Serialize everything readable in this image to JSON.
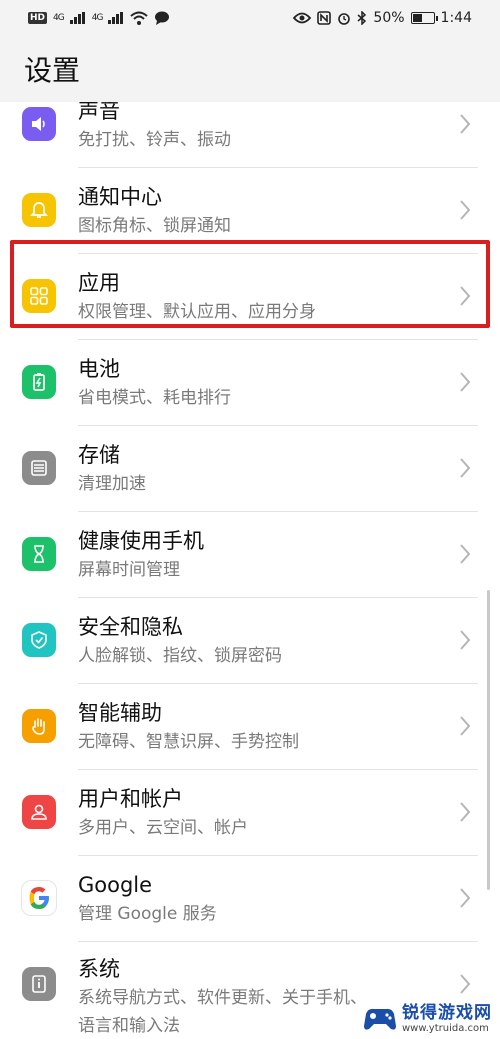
{
  "status_bar": {
    "hd": "HD",
    "signal_1": "4G",
    "signal_2": "4G",
    "battery_percent": "50%",
    "battery_level": 0.5,
    "time": "1:44"
  },
  "header": {
    "title": "设置"
  },
  "settings": [
    {
      "title": "声音",
      "subtitle": "免打扰、铃声、振动",
      "icon": "speaker-icon",
      "color": "#7a5cf0"
    },
    {
      "title": "通知中心",
      "subtitle": "图标角标、锁屏通知",
      "icon": "bell-icon",
      "color": "#f6c400"
    },
    {
      "title": "应用",
      "subtitle": "权限管理、默认应用、应用分身",
      "icon": "apps-grid-icon",
      "color": "#f6c400"
    },
    {
      "title": "电池",
      "subtitle": "省电模式、耗电排行",
      "icon": "battery-icon",
      "color": "#1dc16a"
    },
    {
      "title": "存储",
      "subtitle": "清理加速",
      "icon": "storage-icon",
      "color": "#8c8c8c"
    },
    {
      "title": "健康使用手机",
      "subtitle": "屏幕时间管理",
      "icon": "hourglass-icon",
      "color": "#1dc16a"
    },
    {
      "title": "安全和隐私",
      "subtitle": "人脸解锁、指纹、锁屏密码",
      "icon": "shield-icon",
      "color": "#20c4c0"
    },
    {
      "title": "智能辅助",
      "subtitle": "无障碍、智慧识屏、手势控制",
      "icon": "hand-icon",
      "color": "#f6a000"
    },
    {
      "title": "用户和帐户",
      "subtitle": "多用户、云空间、帐户",
      "icon": "user-icon",
      "color": "#ef4545"
    },
    {
      "title": "Google",
      "subtitle": "管理 Google 服务",
      "icon": "google-icon",
      "color": "#ffffff"
    },
    {
      "title": "系统",
      "subtitle": "系统导航方式、软件更新、关于手机、",
      "subtitle2": "语言和输入法",
      "icon": "phone-info-icon",
      "color": "#8c8c8c"
    }
  ],
  "watermark": {
    "title": "锐得游戏网",
    "url": "www.ytruida.com"
  }
}
